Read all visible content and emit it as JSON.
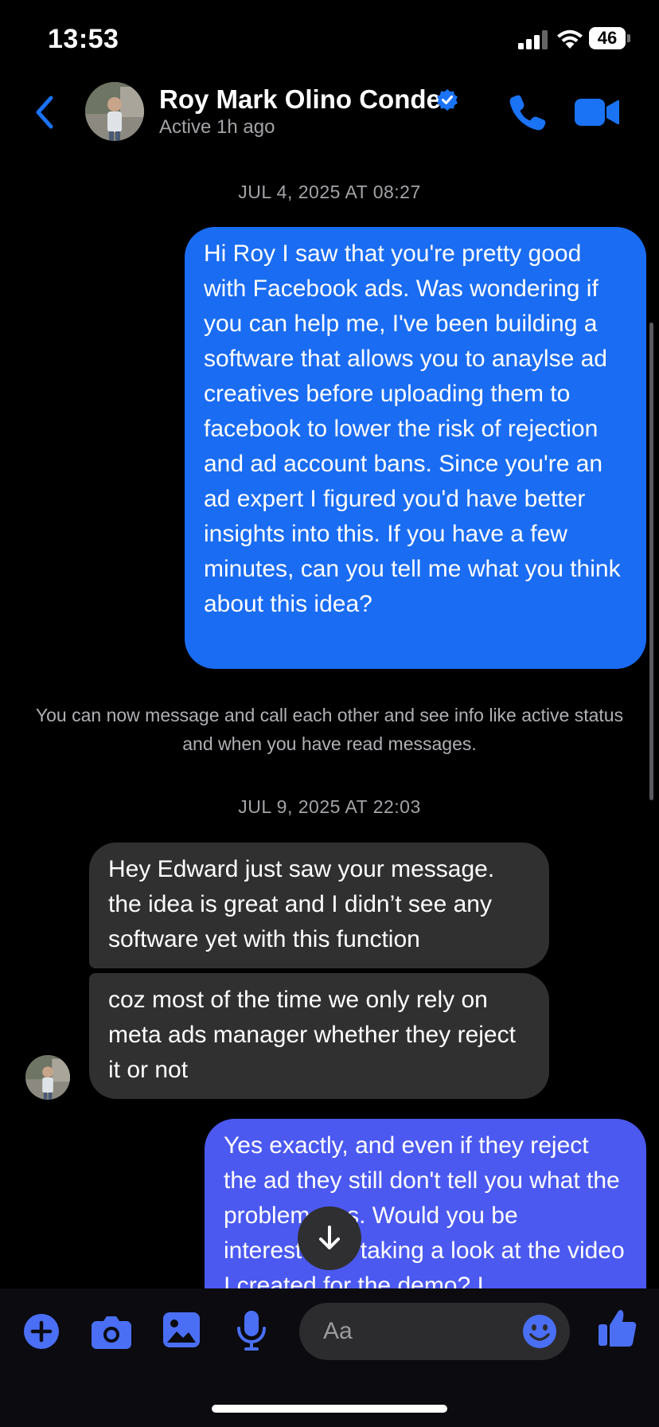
{
  "status_bar": {
    "time": "13:53",
    "battery": "46"
  },
  "header": {
    "contact_name": "Roy Mark Olino Conde",
    "contact_status": "Active 1h ago"
  },
  "messages": {
    "timestamp_1": "JUL 4, 2025 AT 08:27",
    "outgoing_1": "Hi Roy I saw that you're pretty good with Facebook ads. Was wondering if you can help me, I've been building a software that allows you to anaylse ad creatives before uploading them to facebook to lower the risk of rejection and ad account bans. Since you're an ad expert I figured you'd have better insights into this. If you have a few minutes, can you tell me what you think about this idea?",
    "system_notice": "You can now message and call each other and see info like active status and when you have read messages.",
    "timestamp_2": "JUL 9, 2025 AT 22:03",
    "incoming_1": "Hey Edward just saw your message. the idea is great and I didn’t see any software yet with this function",
    "incoming_2": "coz most of the time we only rely on meta ads manager whether they reject it or not",
    "outgoing_2": "Yes exactly, and even if they reject the ad they still don't tell you what the problem was. Would you be interested in taking a look at the video I created for the demo? I"
  },
  "composer": {
    "placeholder": "Aa"
  },
  "colors": {
    "accent": "#1a6cf2",
    "outgoing_bubble": "#1a6cf2",
    "outgoing_bubble_2": "#4b59f0",
    "incoming_bubble": "#303030",
    "composer_icon": "#4a6ff5"
  },
  "icons": [
    "back-icon",
    "verified-icon",
    "call-icon",
    "video-icon",
    "scroll-down-icon",
    "plus-icon",
    "camera-icon",
    "image-icon",
    "microphone-icon",
    "emoji-icon",
    "thumbs-up-icon"
  ]
}
